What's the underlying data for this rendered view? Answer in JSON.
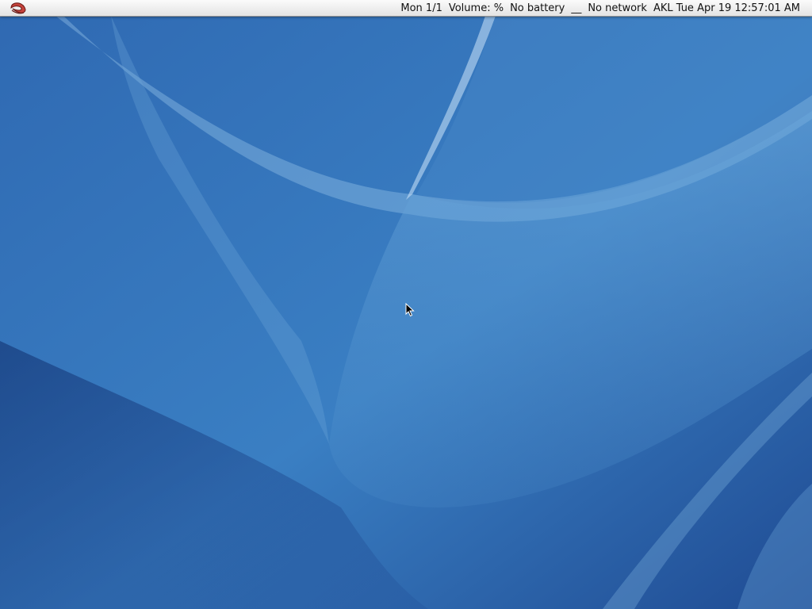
{
  "menubar": {
    "logo_icon": "app-menu-logo-icon",
    "status": {
      "workspace": "Mon 1/1",
      "volume": "Volume: %",
      "battery": "No battery",
      "separator": "__",
      "network": "No network",
      "clock": "AKL Tue Apr 19 12:57:01 AM"
    }
  },
  "desktop": {
    "wallpaper_icon": "aqua-blue-wallpaper",
    "colors": {
      "base": "#2e67ad",
      "highlight": "#7fb4e0",
      "dark": "#1d4384"
    }
  },
  "pointer": {
    "icon": "arrow-cursor-icon"
  }
}
